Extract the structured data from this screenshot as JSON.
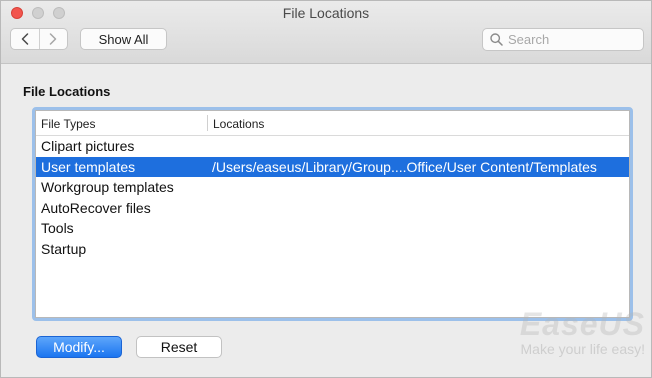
{
  "window": {
    "title": "File Locations"
  },
  "toolbar": {
    "show_all_label": "Show All",
    "search_placeholder": "Search",
    "back_icon": "chevron-left-icon",
    "forward_icon": "chevron-right-icon",
    "search_icon": "magnifier-icon"
  },
  "section": {
    "title": "File Locations"
  },
  "table": {
    "columns": [
      "File Types",
      "Locations"
    ],
    "rows": [
      {
        "type": "Clipart pictures",
        "location": ""
      },
      {
        "type": "User templates",
        "location": "/Users/easeus/Library/Group....Office/User Content/Templates",
        "selected": true
      },
      {
        "type": "Workgroup templates",
        "location": ""
      },
      {
        "type": "AutoRecover files",
        "location": ""
      },
      {
        "type": "Tools",
        "location": ""
      },
      {
        "type": "Startup",
        "location": ""
      }
    ]
  },
  "buttons": {
    "modify_label": "Modify...",
    "reset_label": "Reset"
  },
  "watermark": {
    "brand": "EaseUS",
    "tagline": "Make your life easy!"
  },
  "colors": {
    "selection": "#1e6fde",
    "focus_ring": "#9cc0ea",
    "primary_button": "#1b75f0"
  }
}
